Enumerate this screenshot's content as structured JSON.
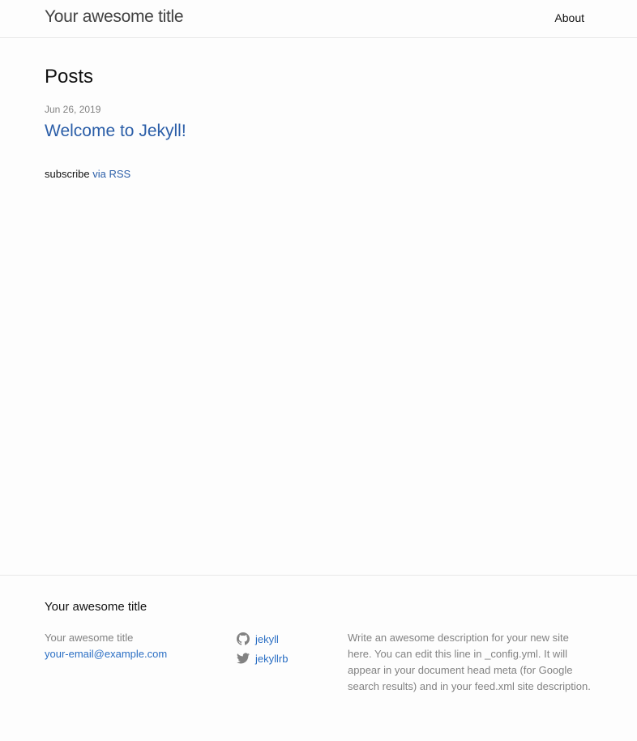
{
  "header": {
    "site_title": "Your awesome title",
    "nav": [
      {
        "label": "About"
      }
    ]
  },
  "main": {
    "heading": "Posts",
    "posts": [
      {
        "date": "Jun 26, 2019",
        "title": "Welcome to Jekyll!"
      }
    ],
    "rss": {
      "prefix": "subscribe",
      "link_label": "via RSS"
    }
  },
  "footer": {
    "heading": "Your awesome title",
    "site_name": "Your awesome title",
    "email": "your-email@example.com",
    "social": [
      {
        "icon": "github-icon",
        "username": "jekyll"
      },
      {
        "icon": "twitter-icon",
        "username": "jekyllrb"
      }
    ],
    "description": "Write an awesome description for your new site here. You can edit this line in _config.yml. It will appear in your document head meta (for Google search results) and in your feed.xml site description."
  },
  "colors": {
    "background": "#fdfdfd",
    "text": "#111111",
    "grey": "#828282",
    "link": "#2b5ea8",
    "border": "#e8e8e8"
  }
}
